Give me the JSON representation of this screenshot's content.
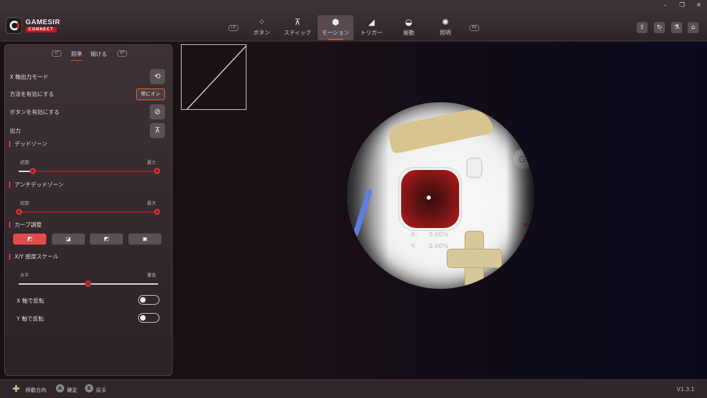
{
  "app": {
    "brand": "GAMESIR",
    "brand_sub": "CONNECT",
    "version": "V1.3.1"
  },
  "nav": {
    "left_bumper": "LB",
    "right_bumper": "RB",
    "tabs": [
      {
        "label": "ボタン",
        "icon": "buttons-icon"
      },
      {
        "label": "スティック",
        "icon": "stick-icon"
      },
      {
        "label": "モーション",
        "icon": "motion-cube-icon",
        "active": true
      },
      {
        "label": "トリガー",
        "icon": "trigger-icon"
      },
      {
        "label": "振動",
        "icon": "controller-vibration-icon"
      },
      {
        "label": "照明",
        "icon": "lightbulb-icon"
      }
    ]
  },
  "panel": {
    "lt": "LT",
    "rt": "RT",
    "subtabs": [
      "照準",
      "傾ける"
    ],
    "rows": {
      "x_output_mode": "X 軸出力モード",
      "enable_method": "方法を有効にする",
      "enable_method_value": "常にオン",
      "enable_button": "ボタンを有効にする",
      "output": "出力"
    },
    "deadzone": {
      "title": "デッドゾーン",
      "min_label": "初期",
      "max_label": "最大",
      "low": 0.1,
      "high": 1.0
    },
    "anti_deadzone": {
      "title": "アンチデッドゾーン",
      "min_label": "初期",
      "max_label": "最大",
      "low": 0.0,
      "high": 1.0
    },
    "curve": {
      "title": "カーブ調整",
      "options": [
        "linear-curve-icon",
        "curve-2-icon",
        "curve-3-icon",
        "curve-4-icon"
      ],
      "selected": 0
    },
    "xy_scale": {
      "title": "X/Y 感度スケール",
      "left_label": "水平",
      "right_label": "垂直",
      "value": 0.5
    },
    "invert_x": {
      "label": "X 軸で反転",
      "on": false
    },
    "invert_y": {
      "label": "Y 軸で反転",
      "on": false
    }
  },
  "readout": {
    "x_label": "X:",
    "x_value": "0.00%",
    "y_label": "Y:",
    "y_value": "0.00%"
  },
  "footer": {
    "move": "移動方向",
    "confirm_btn": "A",
    "confirm": "確定",
    "back_btn": "B",
    "back": "戻る"
  },
  "colors": {
    "accent": "#e34b4b",
    "highlight": "#e8652e"
  }
}
